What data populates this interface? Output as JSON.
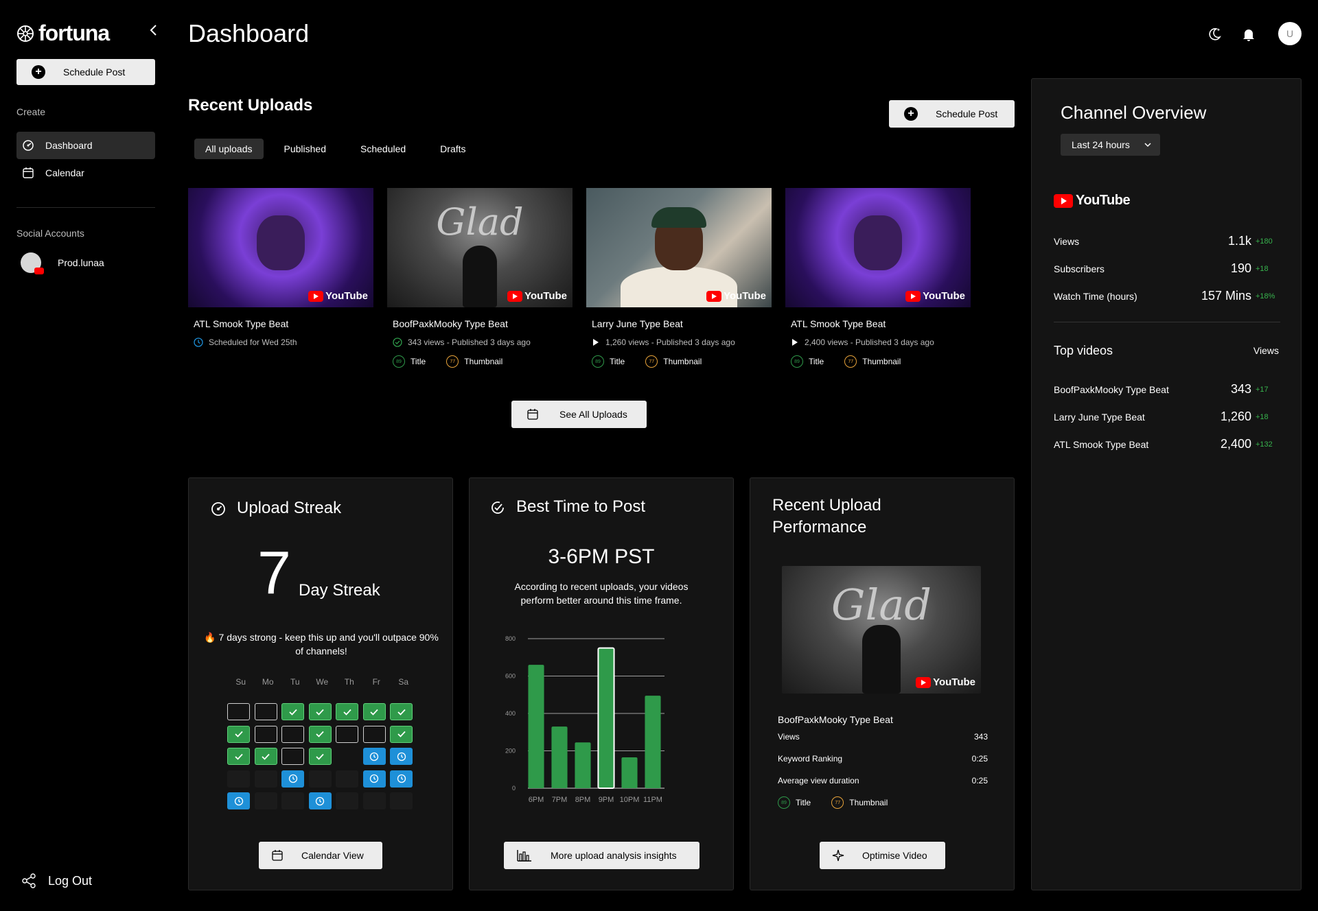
{
  "app": {
    "name": "fortuna"
  },
  "sidebar": {
    "schedule_label": "Schedule Post",
    "create_heading": "Create",
    "items": [
      {
        "label": "Dashboard",
        "icon": "dashboard-icon"
      },
      {
        "label": "Calendar",
        "icon": "calendar-icon"
      }
    ],
    "social_heading": "Social Accounts",
    "account": {
      "name": "Prod.lunaa"
    },
    "logout_label": "Log Out"
  },
  "header": {
    "title": "Dashboard",
    "avatar_initial": "U"
  },
  "uploads": {
    "title": "Recent Uploads",
    "schedule_label": "Schedule Post",
    "tabs": [
      "All uploads",
      "Published",
      "Scheduled",
      "Drafts"
    ],
    "see_all_label": "See All Uploads",
    "cards": [
      {
        "title": "ATL Smook Type Beat",
        "meta": "Scheduled for Wed 25th",
        "status": "scheduled",
        "thumb": "purple"
      },
      {
        "title": "BoofPaxkMooky Type Beat",
        "meta": "343 views - Published 3 days ago",
        "status": "published",
        "thumb": "silver",
        "title_score": "89",
        "thumb_score": "77"
      },
      {
        "title": "Larry June Type Beat",
        "meta": "1,260 views - Published 3 days ago",
        "status": "playing",
        "thumb": "person",
        "title_score": "89",
        "thumb_score": "77"
      },
      {
        "title": "ATL Smook Type Beat",
        "meta": "2,400 views - Published 3 days ago",
        "status": "playing",
        "thumb": "purple",
        "title_score": "89",
        "thumb_score": "77"
      }
    ],
    "tag_title": "Title",
    "tag_thumbnail": "Thumbnail",
    "thumb_texts": {
      "glad": "Glad",
      "youtube": "YouTube"
    }
  },
  "streak": {
    "title": "Upload Streak",
    "count": "7",
    "label": "Day Streak",
    "message": "🔥 7 days strong - keep this up and you'll outpace 90% of channels!",
    "days": [
      "Su",
      "Mo",
      "Tu",
      "We",
      "Th",
      "Fr",
      "Sa"
    ],
    "grid": [
      [
        "empty",
        "empty",
        "done",
        "done",
        "done",
        "done",
        "done"
      ],
      [
        "done",
        "empty",
        "empty",
        "done",
        "empty",
        "empty",
        "done"
      ],
      [
        "done",
        "done",
        "empty",
        "done",
        "none",
        "sched",
        "sched"
      ],
      [
        "future",
        "future",
        "sched",
        "future",
        "future",
        "sched",
        "sched"
      ],
      [
        "sched",
        "future",
        "future",
        "sched",
        "future",
        "future",
        "future"
      ]
    ],
    "button_label": "Calendar View"
  },
  "best_time": {
    "title": "Best Time to Post",
    "time": "3-6PM PST",
    "description": "According to recent uploads, your videos perform better around this time frame.",
    "button_label": "More upload analysis insights"
  },
  "chart_data": {
    "type": "bar",
    "categories": [
      "6PM",
      "7PM",
      "8PM",
      "9PM",
      "10PM",
      "11PM"
    ],
    "values": [
      660,
      330,
      245,
      750,
      165,
      495
    ],
    "highlight_index": 3,
    "ylim": [
      0,
      800
    ],
    "yticks": [
      0,
      200,
      400,
      600,
      800
    ],
    "grid": true,
    "colors": {
      "bar": "#2f9a4a",
      "highlight_border": "#ffffff"
    }
  },
  "performance": {
    "title_line1": "Recent Upload",
    "title_line2": "Performance",
    "video_name": "BoofPaxkMooky Type Beat",
    "rows": [
      {
        "label": "Views",
        "value": "343"
      },
      {
        "label": "Keyword Ranking",
        "value": "0:25"
      },
      {
        "label": "Average view duration",
        "value": "0:25"
      }
    ],
    "title_score": "89",
    "thumb_score": "77",
    "button_label": "Optimise Video"
  },
  "overview": {
    "title": "Channel Overview",
    "range": "Last 24 hours",
    "platform": "YouTube",
    "stats": [
      {
        "label": "Views",
        "value": "1.1k",
        "delta": "+180"
      },
      {
        "label": "Subscribers",
        "value": "190",
        "delta": "+18"
      },
      {
        "label": "Watch Time (hours)",
        "value": "157 Mins",
        "delta": "+18%"
      }
    ],
    "top_title": "Top videos",
    "top_col": "Views",
    "top_videos": [
      {
        "name": "BoofPaxkMooky Type Beat",
        "views": "343",
        "delta": "+17"
      },
      {
        "name": "Larry June Type Beat",
        "views": "1,260",
        "delta": "+18"
      },
      {
        "name": "ATL Smook Type Beat",
        "views": "2,400",
        "delta": "+132"
      }
    ]
  },
  "colors": {
    "accent_green": "#2f9a4a",
    "delta_green": "#37b24d",
    "schedule_blue": "#1e90d8",
    "score_orange": "#e8a33a",
    "youtube_red": "#ff0000"
  }
}
